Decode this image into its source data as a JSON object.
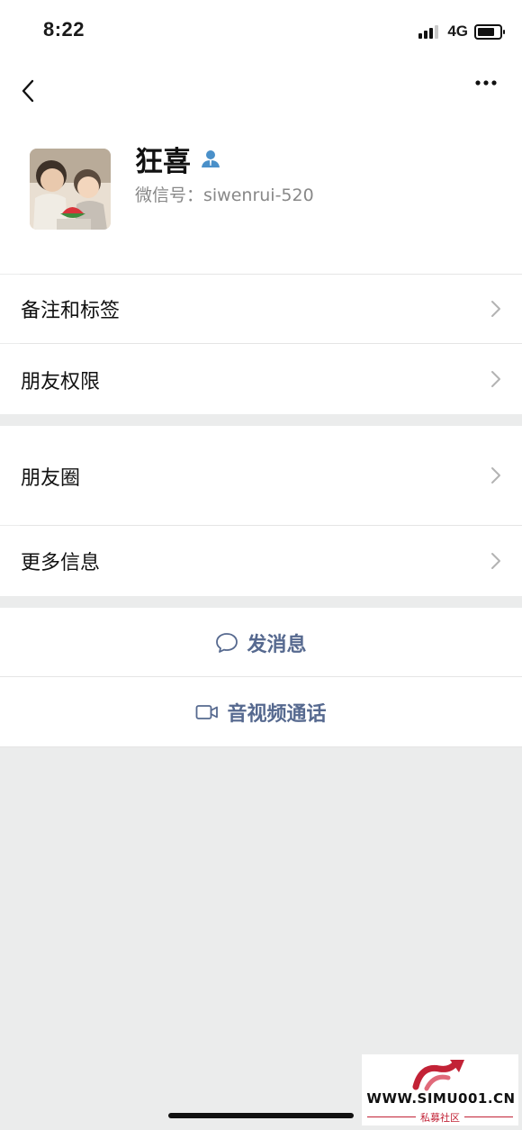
{
  "status_bar": {
    "time": "8:22",
    "network": "4G"
  },
  "nav": {
    "back_icon": "chevron-left-icon",
    "more_icon": "more-horizontal-icon"
  },
  "profile": {
    "name": "狂喜",
    "wechat_id": "微信号：siwenrui-520",
    "badge_icon": "user-icon",
    "badge_color": "#4a90c9"
  },
  "settings_group_1": [
    {
      "label": "备注和标签"
    },
    {
      "label": "朋友权限"
    }
  ],
  "settings_group_2": [
    {
      "label": "朋友圈"
    },
    {
      "label": "更多信息"
    }
  ],
  "actions": {
    "message": {
      "label": "发消息",
      "icon": "chat-bubble-icon"
    },
    "call": {
      "label": "音视频通话",
      "icon": "video-camera-icon"
    },
    "color": "#56698f"
  },
  "watermark": {
    "text": "WWW.SIMU001.CN",
    "subtext": "私募社区",
    "color": "#c22236"
  }
}
